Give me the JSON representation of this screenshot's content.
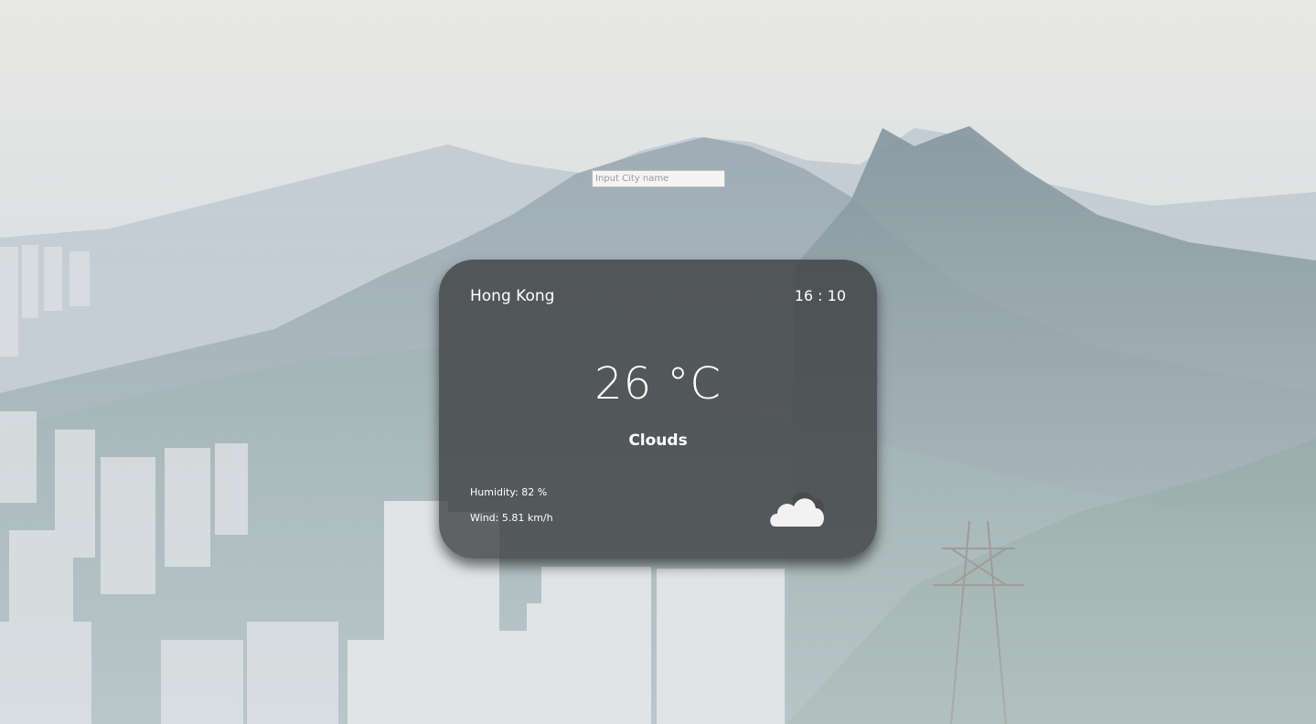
{
  "search": {
    "placeholder": "Input City name",
    "value": ""
  },
  "weather": {
    "city": "Hong Kong",
    "time": "16 : 10",
    "temperature": "26 °C",
    "condition": "Clouds",
    "humidity": "Humidity: 82 %",
    "wind": "Wind: 5.81 km/h",
    "icon": "cloud-icon"
  },
  "colors": {
    "card_background": "#3a3c3d",
    "text": "#ffffff"
  }
}
